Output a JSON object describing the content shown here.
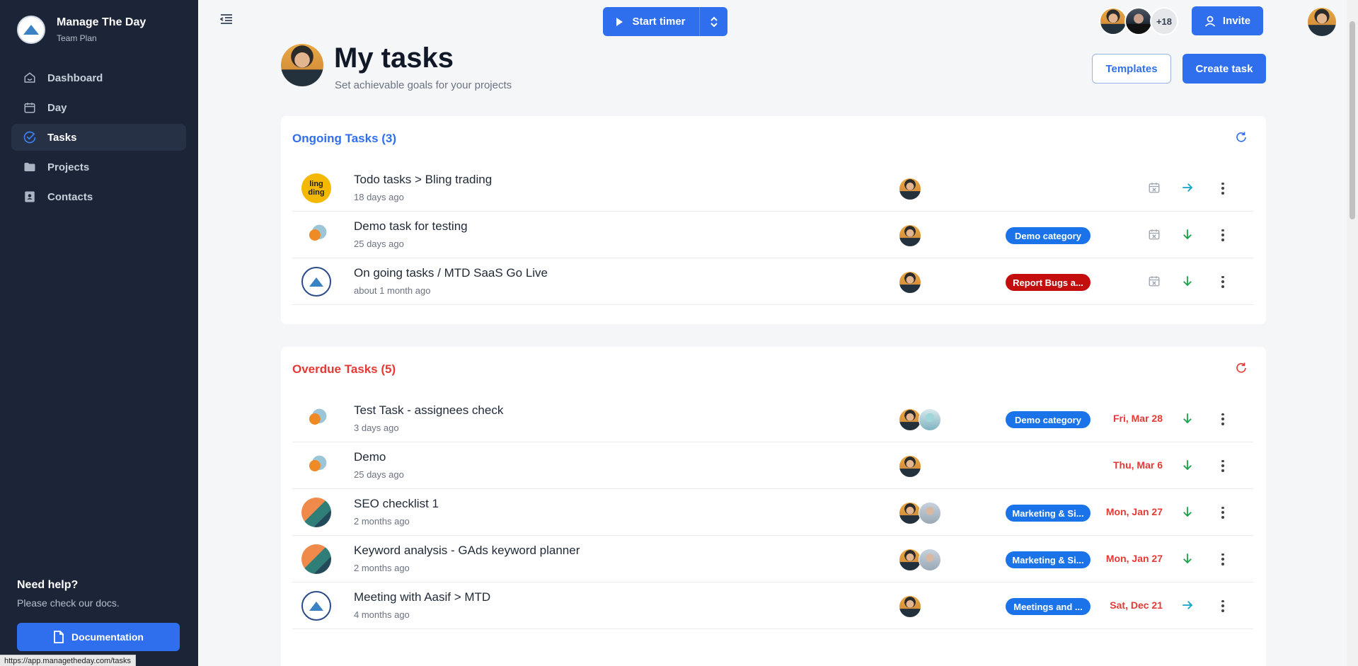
{
  "app": {
    "name": "Manage The Day",
    "plan": "Team Plan"
  },
  "sidebar": {
    "items": [
      {
        "label": "Dashboard",
        "icon": "home-icon",
        "active": false
      },
      {
        "label": "Day",
        "icon": "calendar-icon",
        "active": false
      },
      {
        "label": "Tasks",
        "icon": "check-circle-icon",
        "active": true
      },
      {
        "label": "Projects",
        "icon": "folder-icon",
        "active": false
      },
      {
        "label": "Contacts",
        "icon": "contact-card-icon",
        "active": false
      }
    ],
    "help_title": "Need help?",
    "help_sub": "Please check our docs.",
    "doc_button": "Documentation"
  },
  "status_url": "https://app.managetheday.com/tasks",
  "topbar": {
    "timer_label": "Start timer",
    "extra_members": "+18",
    "invite_label": "Invite"
  },
  "header": {
    "title": "My tasks",
    "subtitle": "Set achievable goals for your projects",
    "templates_label": "Templates",
    "create_label": "Create task"
  },
  "ongoing": {
    "title": "Ongoing Tasks (3)",
    "rows": [
      {
        "title": "Todo tasks > Bling trading",
        "time": "18 days ago",
        "logo": "bling",
        "logo_text": "ling\nding",
        "tag": "",
        "action": "arrow-right"
      },
      {
        "title": "Demo task for testing",
        "time": "25 days ago",
        "logo": "dragon",
        "tag": "Demo category",
        "tag_color": "#1a73e8",
        "action": "arrow-down"
      },
      {
        "title": "On going tasks / MTD SaaS Go Live",
        "time": "about 1 month ago",
        "logo": "mtd",
        "tag": "Report Bugs a...",
        "tag_color": "#c40e0e",
        "action": "arrow-down"
      }
    ]
  },
  "overdue": {
    "title": "Overdue Tasks (5)",
    "rows": [
      {
        "title": "Test Task - assignees check",
        "time": "3 days ago",
        "logo": "dragon",
        "tag": "Demo category",
        "due": "Fri, Mar 28",
        "action": "arrow-down"
      },
      {
        "title": "Demo",
        "time": "25 days ago",
        "logo": "dragon",
        "tag": "",
        "due": "Thu, Mar 6",
        "action": "arrow-down"
      },
      {
        "title": "SEO checklist 1",
        "time": "2 months ago",
        "logo": "seo",
        "tag": "Marketing & Si...",
        "due": "Mon, Jan 27",
        "action": "arrow-down"
      },
      {
        "title": "Keyword analysis - GAds keyword planner",
        "time": "2 months ago",
        "logo": "seo",
        "tag": "Marketing & Si...",
        "due": "Mon, Jan 27",
        "action": "arrow-down"
      },
      {
        "title": "Meeting with Aasif > MTD",
        "time": "4 months ago",
        "logo": "mtd",
        "tag": "Meetings and ...",
        "due": "Sat, Dec 21",
        "action": "arrow-right"
      }
    ]
  },
  "colors": {
    "sidebar_bg": "#1c2537",
    "accent": "#2f6fed",
    "overdue_red": "#e53935",
    "arrow_green": "#16a34a",
    "arrow_cyan": "#0ea5c9"
  }
}
